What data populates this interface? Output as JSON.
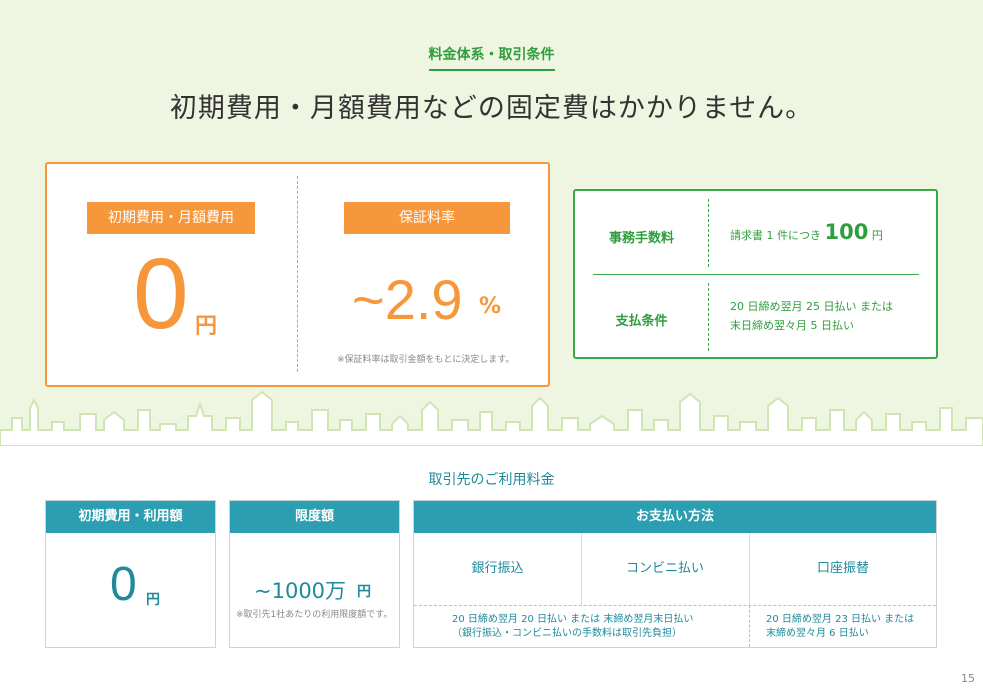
{
  "header": {
    "section_label": "料金体系・取引条件",
    "headline": "初期費用・月額費用などの固定費はかかりません。"
  },
  "orange_box": {
    "left": {
      "label": "初期費用・月額費用",
      "value": "0",
      "unit": "円"
    },
    "right": {
      "label": "保証料率",
      "value": "~2.9",
      "unit": "%",
      "note": "※保証料率は取引金額をもとに決定します。"
    }
  },
  "green_box": {
    "fee": {
      "key": "事務手数料",
      "prefix": "請求書 1 件につき",
      "amount": "100",
      "unit": "円"
    },
    "terms": {
      "key": "支払条件",
      "line1": "20 日締め翌月 25 日払い または",
      "line2": "末日締め翌々月 5 日払い"
    }
  },
  "client_fees": {
    "title": "取引先のご利用料金",
    "initial": {
      "header": "初期費用・利用額",
      "value": "0",
      "unit": "円"
    },
    "limit": {
      "header": "限度額",
      "value": "~1000万",
      "unit": "円",
      "note": "※取引先1社あたりの利用限度額です。"
    },
    "payment": {
      "header": "お支払い方法",
      "methods": [
        "銀行振込",
        "コンビニ払い",
        "口座振替"
      ],
      "note_left_1": "20 日締め翌月 20 日払い または 末締め翌月末日払い",
      "note_left_2": "（銀行振込・コンビニ払いの手数料は取引先負担）",
      "note_right_1": "20 日締め翌月 23 日払い または",
      "note_right_2": "末締め翌々月 6 日払い"
    }
  },
  "page_number": "15",
  "colors": {
    "orange": "#f5973a",
    "green": "#2e9e3e",
    "teal": "#2b9fb1",
    "band": "#eef5e0"
  }
}
